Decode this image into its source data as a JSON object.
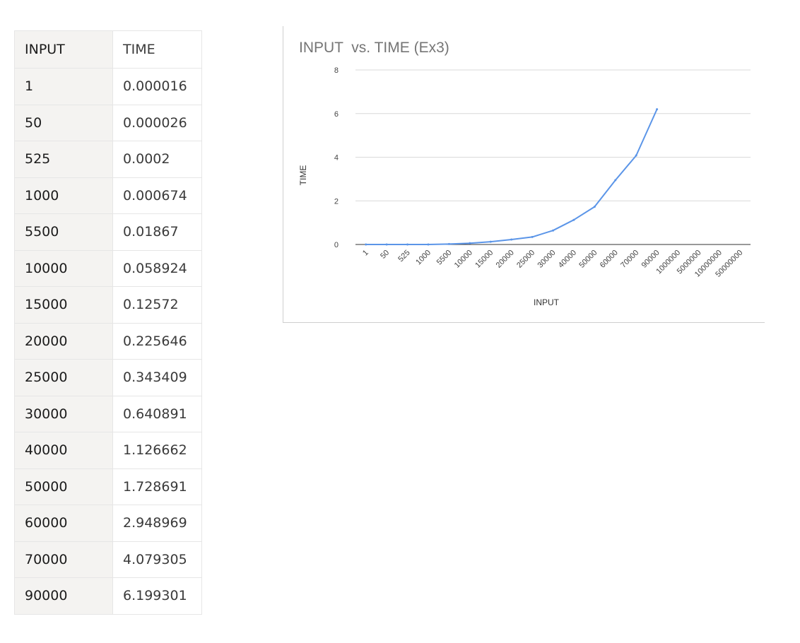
{
  "table": {
    "headers": [
      "INPUT",
      "TIME"
    ],
    "rows": [
      [
        "1",
        "0.000016"
      ],
      [
        "50",
        "0.000026"
      ],
      [
        "525",
        "0.0002"
      ],
      [
        "1000",
        "0.000674"
      ],
      [
        "5500",
        "0.01867"
      ],
      [
        "10000",
        "0.058924"
      ],
      [
        "15000",
        "0.12572"
      ],
      [
        "20000",
        "0.225646"
      ],
      [
        "25000",
        "0.343409"
      ],
      [
        "30000",
        "0.640891"
      ],
      [
        "40000",
        "1.126662"
      ],
      [
        "50000",
        "1.728691"
      ],
      [
        "60000",
        "2.948969"
      ],
      [
        "70000",
        "4.079305"
      ],
      [
        "90000",
        "6.199301"
      ]
    ]
  },
  "chart_data": {
    "type": "line",
    "title": "INPUT  vs. TIME (Ex3)",
    "xlabel": "INPUT",
    "ylabel": "TIME",
    "categories": [
      "1",
      "50",
      "525",
      "1000",
      "5500",
      "10000",
      "15000",
      "20000",
      "25000",
      "30000",
      "40000",
      "50000",
      "60000",
      "70000",
      "90000",
      "1000000",
      "5000000",
      "10000000",
      "50000000"
    ],
    "series": [
      {
        "values": [
          1.6e-05,
          2.6e-05,
          0.0002,
          0.000674,
          0.01867,
          0.058924,
          0.12572,
          0.225646,
          0.343409,
          0.640891,
          1.126662,
          1.728691,
          2.948969,
          4.079305,
          6.199301,
          null,
          null,
          null,
          null
        ],
        "color": "#5b95e8"
      }
    ],
    "ylim": [
      0,
      8
    ],
    "yticks": [
      "0",
      "2",
      "4",
      "6",
      "8"
    ],
    "grid": true,
    "legend": "none"
  }
}
